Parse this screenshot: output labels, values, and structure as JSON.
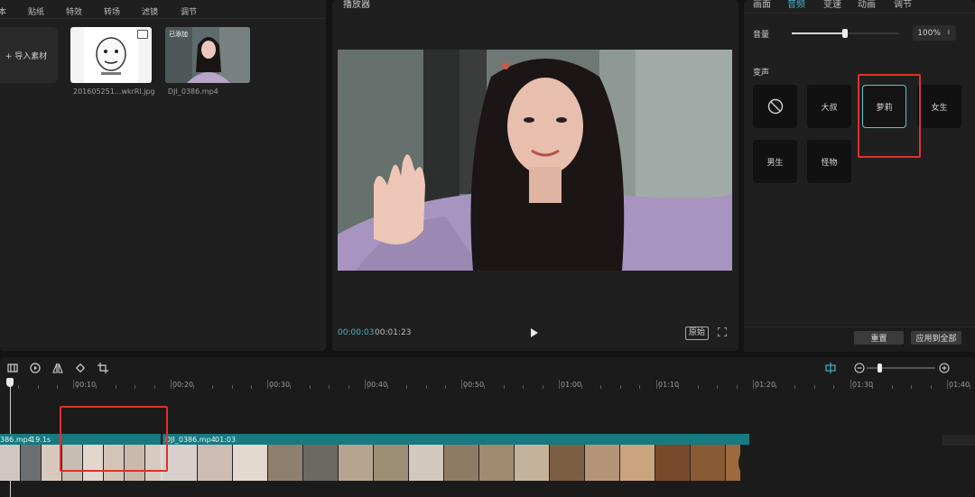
{
  "media": {
    "tabs": [
      "本",
      "贴纸",
      "特效",
      "转场",
      "滤镜",
      "调节"
    ],
    "import_label": "+ 导入素材",
    "items": [
      {
        "filename": "201605251...wkrRl.jpg"
      },
      {
        "filename": "DJI_0386.mp4",
        "badge": "已添加"
      }
    ]
  },
  "player": {
    "title": "播放器",
    "current_time": "00:00:03",
    "total_time": "00:01:23",
    "ratio_label": "原始"
  },
  "props": {
    "tabs": [
      {
        "label": "画面",
        "active": false
      },
      {
        "label": "音频",
        "active": true
      },
      {
        "label": "变速",
        "active": false
      },
      {
        "label": "动画",
        "active": false
      },
      {
        "label": "调节",
        "active": false
      }
    ],
    "volume_label": "音量",
    "volume_value": "100%",
    "volume_level": 0.5,
    "voice_change_label": "变声",
    "voice_options": [
      {
        "label": "",
        "icon": "none-icon",
        "selected": false
      },
      {
        "label": "大叔",
        "selected": false
      },
      {
        "label": "萝莉",
        "selected": true
      },
      {
        "label": "女生",
        "selected": false
      },
      {
        "label": "男生",
        "selected": false
      },
      {
        "label": "怪物",
        "selected": false
      }
    ],
    "reset_label": "重置",
    "apply_all_label": "应用到全部"
  },
  "timeline": {
    "ticks": [
      "00:10",
      "00:20",
      "00:30",
      "00:40",
      "00:50",
      "01:00",
      "01:10",
      "01:20",
      "01:30",
      "01:40"
    ],
    "clips": [
      {
        "name": "386.mp4",
        "duration": "19.1s"
      },
      {
        "name": "DJI_0386.mp4",
        "duration": "01:03"
      }
    ],
    "zoom_level": 0.2
  },
  "colors": {
    "accent": "#3fb5c8",
    "track": "#167a80",
    "highlight": "#e0312a"
  }
}
